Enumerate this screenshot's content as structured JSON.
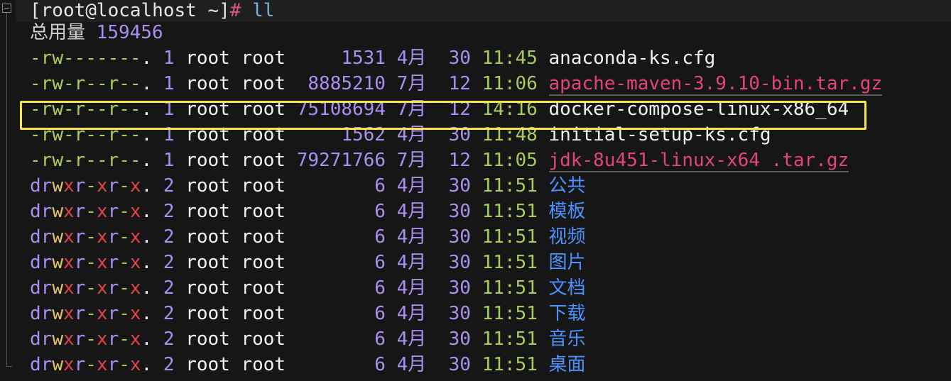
{
  "prompt": {
    "user_host": "[root@localhost ~]",
    "symbol": "#",
    "command": "ll"
  },
  "total": {
    "label": "总用量",
    "value": "159456"
  },
  "colors": {
    "background": "#161616",
    "highlight_box": "#f1e64b",
    "directory_name": "#4b92ff",
    "archive_name": "#e34574"
  },
  "files": [
    {
      "type": "-",
      "perms": "rw-------",
      "dot": ".",
      "links": "1",
      "owner": "root",
      "group": "root",
      "size": "   1531",
      "month": "4月",
      "day": "30",
      "time": "11:45",
      "name": "anaconda-ks.cfg",
      "kind": "file"
    },
    {
      "type": "-",
      "perms": "rw-r--r--",
      "dot": ".",
      "links": "1",
      "owner": "root",
      "group": "root",
      "size": "8885210",
      "month": "7月",
      "day": "12",
      "time": "11:06",
      "name": "apache-maven-3.9.10-bin.tar.gz",
      "kind": "archive"
    },
    {
      "type": "-",
      "perms": "rw-r--r--",
      "dot": ".",
      "links": "1",
      "owner": "root",
      "group": "root",
      "size": "75108694",
      "month": "7月",
      "day": "12",
      "time": "14:16",
      "name": "docker-compose-linux-x86_64",
      "kind": "file",
      "highlighted": true
    },
    {
      "type": "-",
      "perms": "rw-r--r--",
      "dot": ".",
      "links": "1",
      "owner": "root",
      "group": "root",
      "size": "   1562",
      "month": "4月",
      "day": "30",
      "time": "11:48",
      "name": "initial-setup-ks.cfg",
      "kind": "file"
    },
    {
      "type": "-",
      "perms": "rw-r--r--",
      "dot": ".",
      "links": "1",
      "owner": "root",
      "group": "root",
      "size": "79271766",
      "month": "7月",
      "day": "12",
      "time": "11:05",
      "name": "jdk-8u451-linux-x64 .tar.gz",
      "kind": "archive"
    },
    {
      "type": "d",
      "perms": "rwxr-xr-x",
      "dot": ".",
      "links": "2",
      "owner": "root",
      "group": "root",
      "size": "      6",
      "month": "4月",
      "day": "30",
      "time": "11:51",
      "name": "公共",
      "kind": "dir"
    },
    {
      "type": "d",
      "perms": "rwxr-xr-x",
      "dot": ".",
      "links": "2",
      "owner": "root",
      "group": "root",
      "size": "      6",
      "month": "4月",
      "day": "30",
      "time": "11:51",
      "name": "模板",
      "kind": "dir"
    },
    {
      "type": "d",
      "perms": "rwxr-xr-x",
      "dot": ".",
      "links": "2",
      "owner": "root",
      "group": "root",
      "size": "      6",
      "month": "4月",
      "day": "30",
      "time": "11:51",
      "name": "视频",
      "kind": "dir"
    },
    {
      "type": "d",
      "perms": "rwxr-xr-x",
      "dot": ".",
      "links": "2",
      "owner": "root",
      "group": "root",
      "size": "      6",
      "month": "4月",
      "day": "30",
      "time": "11:51",
      "name": "图片",
      "kind": "dir"
    },
    {
      "type": "d",
      "perms": "rwxr-xr-x",
      "dot": ".",
      "links": "2",
      "owner": "root",
      "group": "root",
      "size": "      6",
      "month": "4月",
      "day": "30",
      "time": "11:51",
      "name": "文档",
      "kind": "dir"
    },
    {
      "type": "d",
      "perms": "rwxr-xr-x",
      "dot": ".",
      "links": "2",
      "owner": "root",
      "group": "root",
      "size": "      6",
      "month": "4月",
      "day": "30",
      "time": "11:51",
      "name": "下载",
      "kind": "dir"
    },
    {
      "type": "d",
      "perms": "rwxr-xr-x",
      "dot": ".",
      "links": "2",
      "owner": "root",
      "group": "root",
      "size": "      6",
      "month": "4月",
      "day": "30",
      "time": "11:51",
      "name": "音乐",
      "kind": "dir"
    },
    {
      "type": "d",
      "perms": "rwxr-xr-x",
      "dot": ".",
      "links": "2",
      "owner": "root",
      "group": "root",
      "size": "      6",
      "month": "4月",
      "day": "30",
      "time": "11:51",
      "name": "桌面",
      "kind": "dir"
    }
  ]
}
